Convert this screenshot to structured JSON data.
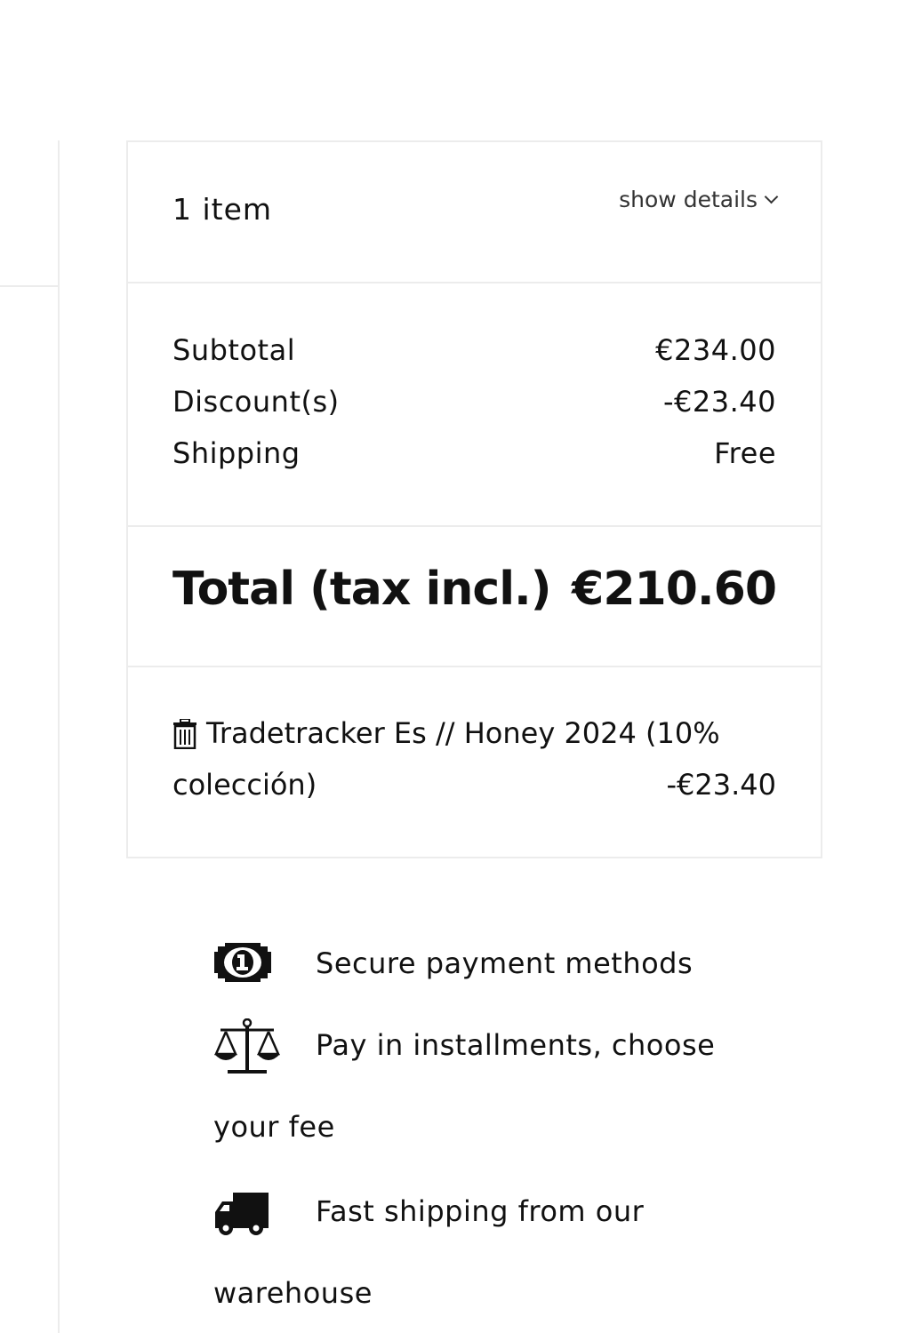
{
  "summary": {
    "item_count": "1 item",
    "show_details_label": "show details",
    "lines": {
      "subtotal_label": "Subtotal",
      "subtotal_value": "€234.00",
      "discount_label": "Discount(s)",
      "discount_value": "-€23.40",
      "shipping_label": "Shipping",
      "shipping_value": "Free"
    },
    "total": {
      "label": "Total (tax incl.)",
      "value": "€210.60"
    },
    "voucher": {
      "name_line1": "Tradetracker Es // Honey 2024 (10%",
      "name_line2": "colección)",
      "amount": "-€23.40",
      "remove_icon": "trash-icon"
    }
  },
  "features": [
    {
      "icon": "banknote-icon",
      "line1": "Secure payment methods",
      "line2": ""
    },
    {
      "icon": "scales-icon",
      "line1": "Pay in installments, choose",
      "line2": "your fee"
    },
    {
      "icon": "truck-icon",
      "line1": "Fast shipping from our",
      "line2": "warehouse"
    }
  ]
}
